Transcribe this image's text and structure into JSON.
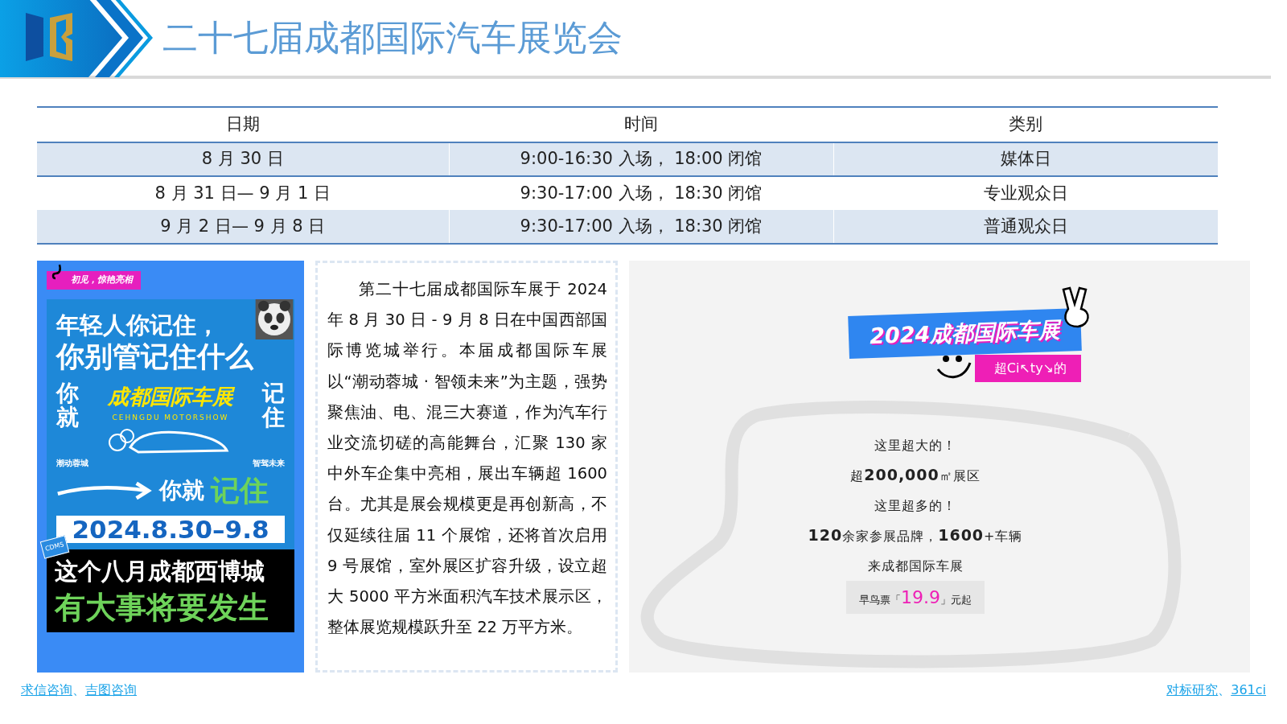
{
  "header": {
    "title": "二十七届成都国际汽车展览会"
  },
  "schedule": {
    "columns": [
      "日期",
      "时间",
      "类别"
    ],
    "rows": [
      {
        "date": "8 月 30 日",
        "time": "9:00-16:30 入场， 18:00 闭馆",
        "category": "媒体日"
      },
      {
        "date": "8 月 31 日— 9 月 1 日",
        "time": "9:30-17:00 入场， 18:30 闭馆",
        "category": "专业观众日"
      },
      {
        "date": "9 月 2 日— 9 月 8 日",
        "time": "9:30-17:00 入场， 18:30 闭馆",
        "category": "普通观众日"
      }
    ]
  },
  "poster": {
    "tag": "初见，惊艳亮相",
    "headline_1": "年轻人你记住，",
    "headline_2": "你别管记住什么",
    "side_left": "你就",
    "logo_title": "成都国际车展",
    "logo_subtitle": "CEHNGDU MOTORSHOW",
    "side_right": "记住",
    "slogan_left": "潮动蓉城",
    "slogan_right": "智驾未来",
    "arrow_text": "你就",
    "arrow_highlight": "记住",
    "dates": "2024.8.30–9.8",
    "badge": "CDMS",
    "bottom_1": "这个八月成都西博城",
    "bottom_2": "有大事将要发生"
  },
  "intro": {
    "text": "第二十七届成都国际车展于 2024 年 8 月 30 日 - 9 月 8 日在中国西部国际博览城举行。本届成都国际车展以“潮动蓉城 · 智领未来”为主题，强势聚焦油、电、混三大赛道，作为汽车行业交流切磋的高能舞台，汇聚 130 家中外车企集中亮相，展出车辆超 1600 台。尤其是展会规模更是再创新高，不仅延续往届 11 个展馆，还将首次启用 9 号展馆，室外展区扩容升级，设立超大 5000 平方米面积汽车技术展示区，整体展览规模跃升至 22 万平方米。"
  },
  "promo": {
    "title": "2024成都国际车展",
    "subtitle": "超Ci↖ty↘的",
    "lines": [
      "这里超大的！",
      "超**200,000**㎡展区",
      "这里超多的！",
      "**120**余家参展品牌，**1600**+车辆",
      "来成都国际车展"
    ],
    "ticket": "早鸟票「**19.9**」元起"
  },
  "footer": {
    "left": [
      {
        "kind": "link",
        "text": "求信咨询"
      },
      {
        "kind": "text",
        "text": "、"
      },
      {
        "kind": "link",
        "text": "吉图咨询"
      }
    ],
    "right": [
      {
        "kind": "link",
        "text": "对标研究"
      },
      {
        "kind": "text",
        "text": "、"
      },
      {
        "kind": "link",
        "text": "361ci"
      }
    ]
  }
}
